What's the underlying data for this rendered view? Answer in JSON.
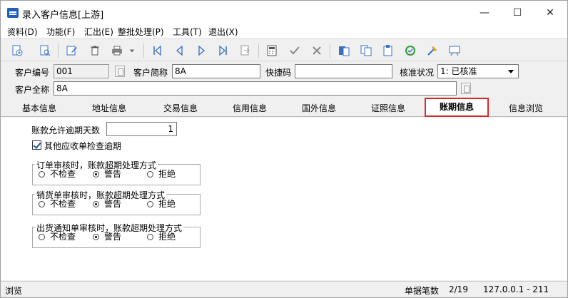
{
  "window": {
    "title": "录入客户信息[上游]",
    "minimize": "—",
    "maximize": "☐",
    "close": "✕"
  },
  "menu": {
    "items": [
      "资料(D)",
      "功能(F)",
      "汇出(E)",
      "整批处理(P)",
      "工具(T)",
      "退出(X)"
    ]
  },
  "toolbar": {
    "icons": [
      "new-record-icon",
      "find-icon",
      "edit-icon",
      "delete-icon",
      "print-icon",
      "print-dropdown-icon",
      "first-record-icon",
      "prev-record-icon",
      "next-record-icon",
      "last-record-icon",
      "goto-icon",
      "calculator-icon",
      "confirm-icon",
      "cancel-icon",
      "report-icon",
      "copy-icon",
      "paste-icon",
      "refresh-icon",
      "tools-icon",
      "help-icon"
    ]
  },
  "form": {
    "code_label": "客户编号",
    "code_value": "001",
    "short_name_label": "客户简称",
    "short_name_value": "8A",
    "quick_code_label": "快捷码",
    "quick_code_value": "",
    "approval_label": "核准状况",
    "approval_value": "1: 已核准",
    "full_name_label": "客户全称",
    "full_name_value": "8A"
  },
  "tabs": [
    "基本信息",
    "地址信息",
    "交易信息",
    "信用信息",
    "国外信息",
    "证照信息",
    "账期信息",
    "信息浏览"
  ],
  "active_tab": "账期信息",
  "aging": {
    "overdue_days_label": "账款允许逾期天数",
    "overdue_days_value": "1",
    "other_receivable_label": "其他应收单检查逾期",
    "other_receivable_checked": true,
    "groups": [
      {
        "title": "订单审核时，账款超期处理方式",
        "options": [
          "不检查",
          "警告",
          "拒绝"
        ],
        "selected": "警告"
      },
      {
        "title": "销货单审核时，账款超期处理方式",
        "options": [
          "不检查",
          "警告",
          "拒绝"
        ],
        "selected": "警告"
      },
      {
        "title": "出货通知单审核时，账款超期处理方式",
        "options": [
          "不检查",
          "警告",
          "拒绝"
        ],
        "selected": "警告"
      }
    ]
  },
  "status": {
    "mode": "浏览",
    "count_label": "单据笔数",
    "count_value": "2/19",
    "server": "127.0.0.1 - 211"
  }
}
